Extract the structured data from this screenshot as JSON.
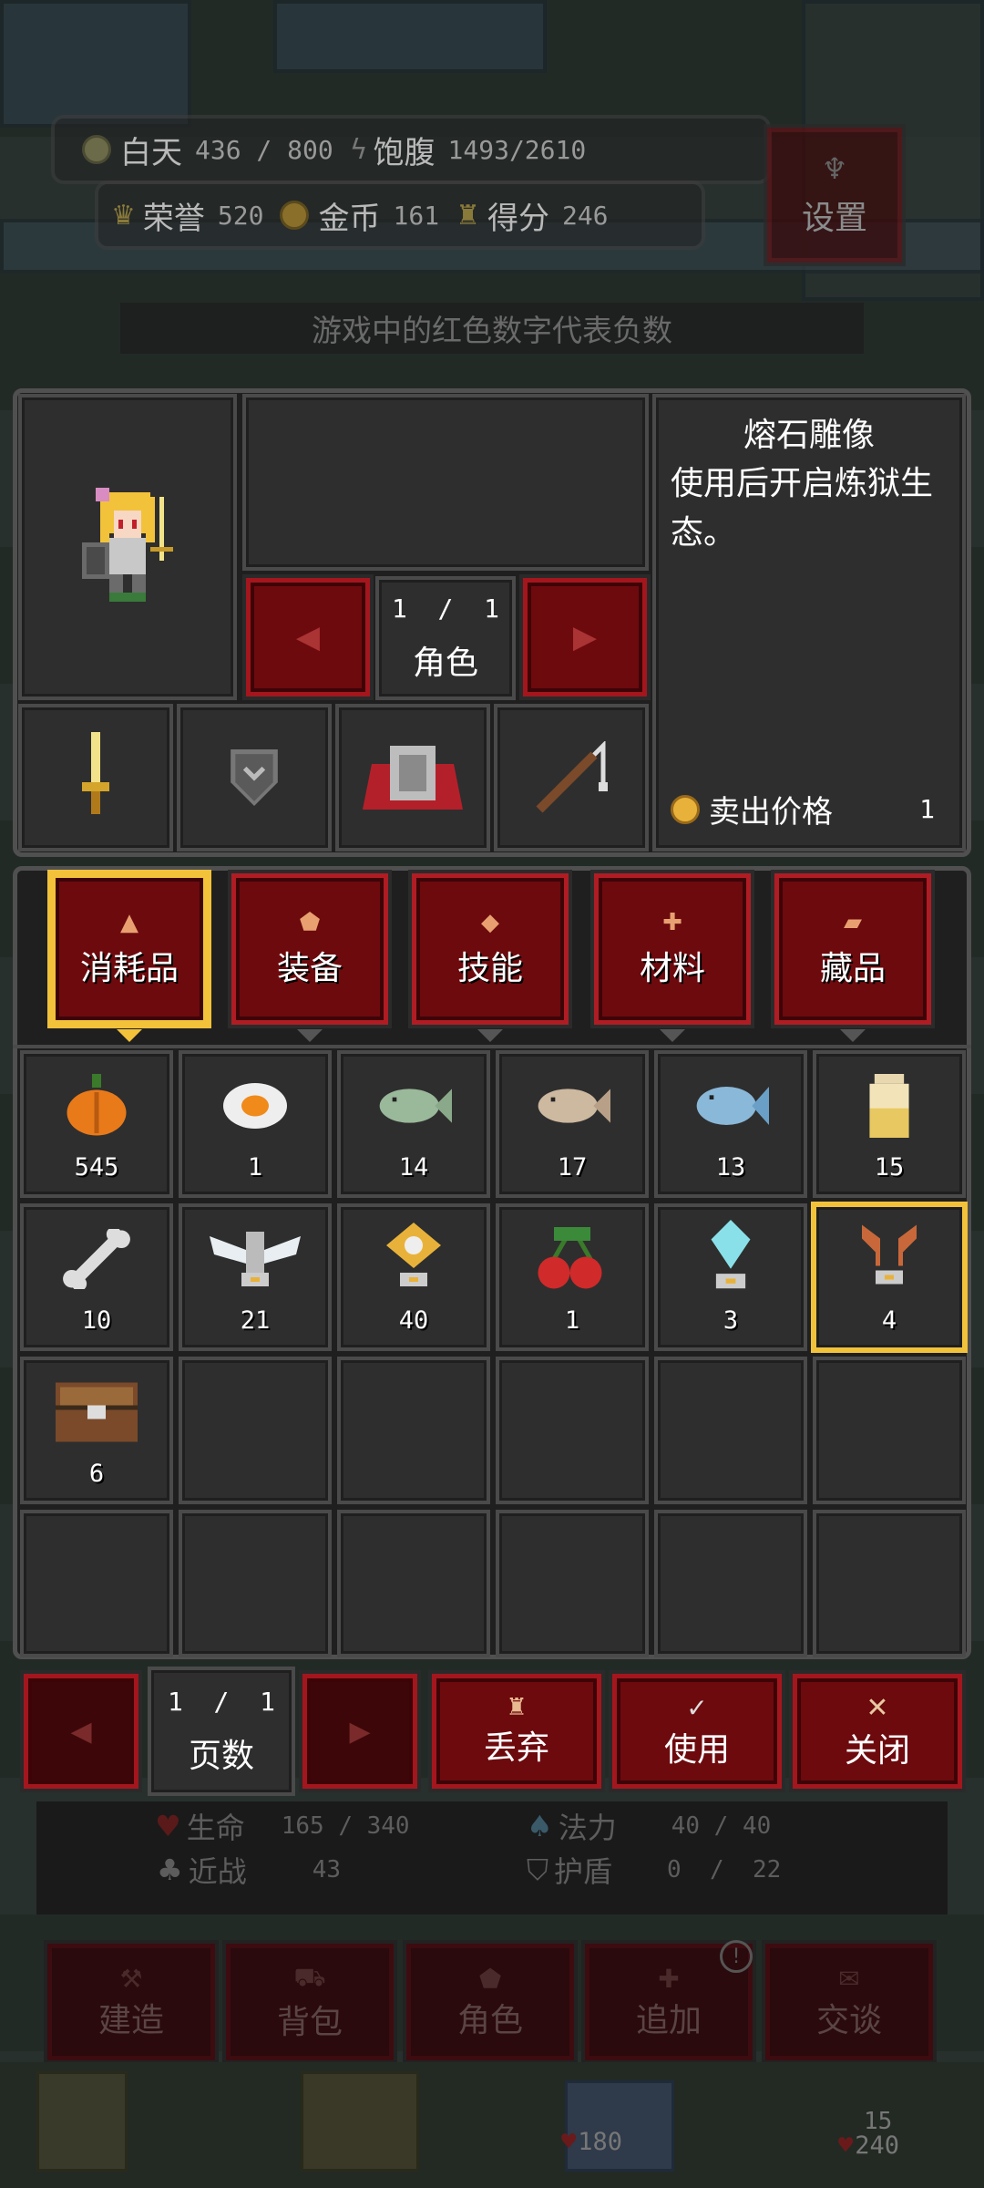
{
  "hud": {
    "day_label": "白天",
    "day_value": "436 / 800",
    "food_label": "饱腹",
    "food_value": "1493/2610",
    "honor_label": "荣誉",
    "honor_value": "520",
    "gold_label": "金币",
    "gold_value": "161",
    "score_label": "得分",
    "score_value": "246",
    "settings_label": "设置",
    "tip": "游戏中的红色数字代表负数"
  },
  "character": {
    "pager": "1  /  1",
    "pager_label": "角色"
  },
  "item_detail": {
    "name": "熔石雕像",
    "desc": "使用后开启炼狱生态。",
    "price_label": "卖出价格",
    "price_value": "1"
  },
  "tabs": [
    {
      "label": "消耗品",
      "icon": "potion-icon",
      "active": true
    },
    {
      "label": "装备",
      "icon": "shield-icon",
      "active": false
    },
    {
      "label": "技能",
      "icon": "diamond-icon",
      "active": false
    },
    {
      "label": "材料",
      "icon": "plus-icon",
      "active": false
    },
    {
      "label": "藏品",
      "icon": "scroll-icon",
      "active": false
    }
  ],
  "inventory": [
    {
      "icon": "pumpkin-icon",
      "count": "545"
    },
    {
      "icon": "fried-egg-icon",
      "count": "1"
    },
    {
      "icon": "green-fish-icon",
      "count": "14"
    },
    {
      "icon": "brown-fish-icon",
      "count": "17"
    },
    {
      "icon": "blue-fish-icon",
      "count": "13"
    },
    {
      "icon": "jar-icon",
      "count": "15"
    },
    {
      "icon": "bone-icon",
      "count": "10"
    },
    {
      "icon": "angel-statue-icon",
      "count": "21"
    },
    {
      "icon": "golden-statue-icon",
      "count": "40"
    },
    {
      "icon": "cherry-icon",
      "count": "1"
    },
    {
      "icon": "crystal-statue-icon",
      "count": "3"
    },
    {
      "icon": "lava-statue-icon",
      "count": "4"
    },
    {
      "icon": "chest-icon",
      "count": "6"
    }
  ],
  "bottom_bar": {
    "pager": "1  /  1",
    "pager_label": "页数",
    "discard_label": "丢弃",
    "use_label": "使用",
    "close_label": "关闭"
  },
  "stats": {
    "hp_label": "生命",
    "hp_value": "165 / 340",
    "mp_label": "法力",
    "mp_value": "40 / 40",
    "melee_label": "近战",
    "melee_value": "43",
    "shield_label": "护盾",
    "shield_value": "0  /  22"
  },
  "menu": [
    {
      "label": "建造"
    },
    {
      "label": "背包"
    },
    {
      "label": "角色"
    },
    {
      "label": "追加"
    },
    {
      "label": "交谈"
    }
  ],
  "ground": {
    "hp_a": "180",
    "hp_b": "15",
    "hp_c": "240"
  }
}
